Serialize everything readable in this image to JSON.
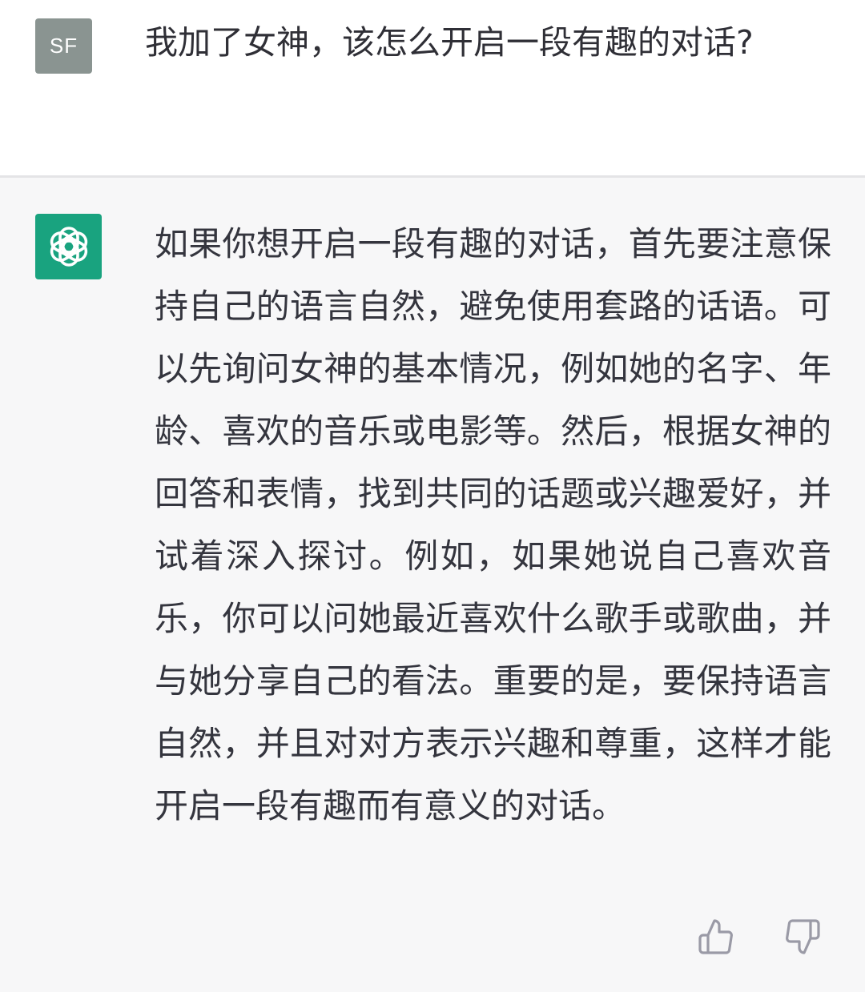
{
  "user_message": {
    "avatar_initials": "SF",
    "text": "我加了女神，该怎么开启一段有趣的对话?"
  },
  "assistant_message": {
    "avatar_icon": "openai-logo-icon",
    "text": "如果你想开启一段有趣的对话，首先要注意保持自己的语言自然，避免使用套路的话语。可以先询问女神的基本情况，例如她的名字、年龄、喜欢的音乐或电影等。然后，根据女神的回答和表情，找到共同的话题或兴趣爱好，并试着深入探讨。例如，如果她说自己喜欢音乐，你可以问她最近喜欢什么歌手或歌曲，并与她分享自己的看法。重要的是，要保持语言自然，并且对对方表示兴趣和尊重，这样才能开启一段有趣而有意义的对话。"
  },
  "feedback": {
    "thumbs_up_icon": "thumbs-up-icon",
    "thumbs_down_icon": "thumbs-down-icon"
  },
  "colors": {
    "assistant_bg": "#f7f7f8",
    "bot_avatar": "#19a37f",
    "user_avatar": "#8a9491",
    "text": "#34353e"
  }
}
